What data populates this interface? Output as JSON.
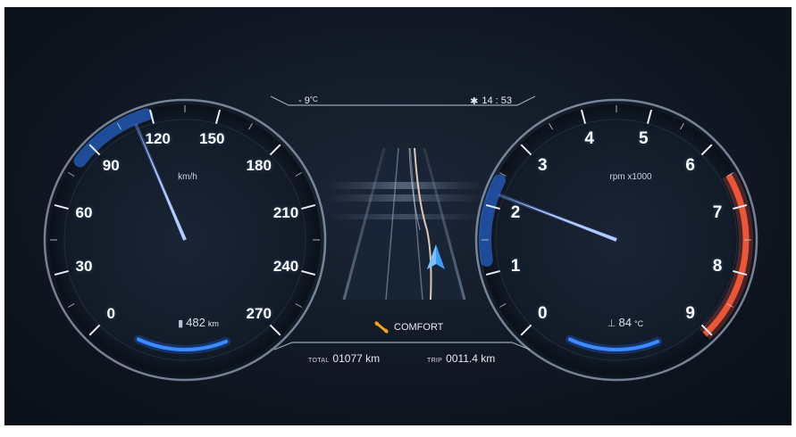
{
  "speedometer": {
    "tick_labels": [
      "0",
      "30",
      "60",
      "90",
      "120",
      "150",
      "180",
      "210",
      "240",
      "270"
    ],
    "unit": "km/h",
    "current_speed_kmh": 112,
    "range_value": "482",
    "range_unit": "km",
    "range_icon": "fuel-pump-icon",
    "accent_color": "#2f7bff"
  },
  "tachometer": {
    "tick_labels": [
      "0",
      "1",
      "2",
      "3",
      "4",
      "5",
      "6",
      "7",
      "8",
      "9"
    ],
    "unit": "rpm x1000",
    "current_rpm_x1000": 2.2,
    "redline_start_x1000": 6.5,
    "coolant_value": "84",
    "coolant_unit": "°C",
    "coolant_icon": "coolant-temperature-icon",
    "accent_color": "#2f7bff",
    "redline_color": "#ff5a3a"
  },
  "status": {
    "outside_temp": "- 9",
    "outside_temp_unit": "°C",
    "bluetooth_icon": "bluetooth-icon",
    "time": "14 : 53"
  },
  "drive_mode": {
    "label": "COMFORT",
    "icon": "suspension-icon",
    "icon_color": "#f2a516"
  },
  "odometer": {
    "total_label": "TOTAL",
    "total_value": "01077 km",
    "trip_label": "TRIP",
    "trip_value": "0011.4 km"
  }
}
